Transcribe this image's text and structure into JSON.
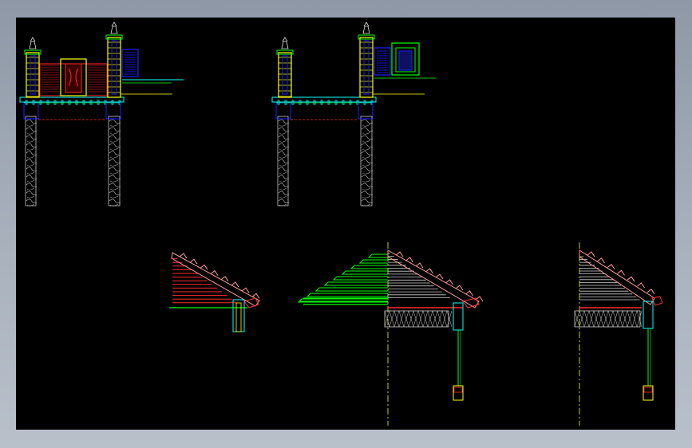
{
  "viewer": {
    "background": "#000000",
    "frame_color": "#9aa3b0"
  },
  "drawing": {
    "layer_colors": {
      "pillar": "#ffff00",
      "outline": "#00ff00",
      "gate_panel": "#ff2a2a",
      "screen": "#2020ff",
      "stone_footing": "#c8c8c8",
      "ground_line": "#00ffff",
      "dash_line": "#ff3030",
      "roof_tile": "#ff9a9a",
      "roof_lines_grey": "#d0d0d0",
      "centerline": "#ffff00",
      "lamp": "#e0e0e0"
    },
    "views": [
      {
        "id": "gate-elevation-left"
      },
      {
        "id": "gate-elevation-right"
      },
      {
        "id": "eave-section-small"
      },
      {
        "id": "roof-section-main"
      },
      {
        "id": "eave-section-right"
      }
    ]
  }
}
